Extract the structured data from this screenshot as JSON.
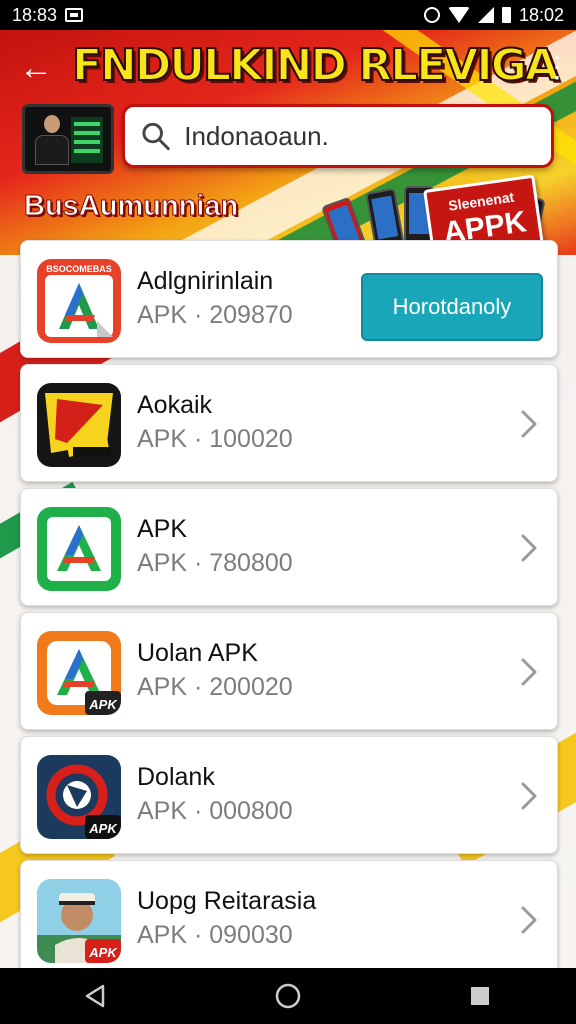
{
  "status_bar": {
    "time_left": "18:83",
    "time_right": "18:02"
  },
  "banner": {
    "title": "FNDULKIND RLEVIGA",
    "subtitle": "BusAumunnian",
    "badge_small": "Sleenenat",
    "badge_big": "APPK"
  },
  "search": {
    "value": "Indonaoaun."
  },
  "apps": [
    {
      "name": "Adlgnirinlain",
      "meta": "APK · 209870",
      "icon": "orange-a-icon",
      "action": "Horotdanoly"
    },
    {
      "name": "Aokaik",
      "meta": "APK · 100020",
      "icon": "yellow-ribbon-icon"
    },
    {
      "name": "APK",
      "meta": "APK · 780800",
      "icon": "green-a-icon"
    },
    {
      "name": "Uolan APK",
      "meta": "APK · 200020",
      "icon": "orange-apk-icon",
      "icon_label": "APK"
    },
    {
      "name": "Dolank",
      "meta": "APK · 000800",
      "icon": "blue-ring-icon",
      "icon_label": "APK"
    },
    {
      "name": "Uopg Reitarasia",
      "meta": "APK · 090030",
      "icon": "person-apk-icon",
      "icon_label": "APK"
    }
  ],
  "icon_header_text": "BSOCOMEBAS",
  "colors": {
    "banner_red": "#d8201a",
    "banner_yellow": "#f8e41a",
    "download_teal": "#1aa6b9"
  }
}
